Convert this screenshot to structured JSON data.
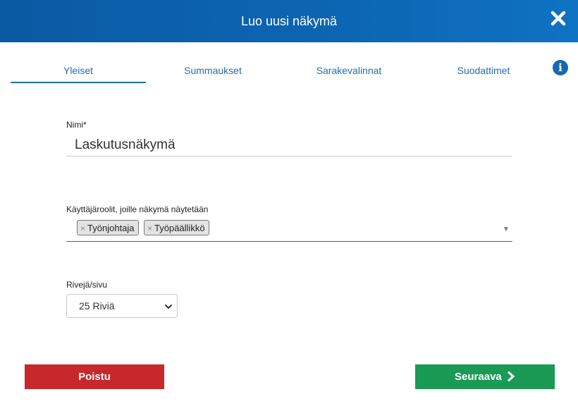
{
  "dialog": {
    "title": "Luo uusi näkymä",
    "close_icon": "close-icon"
  },
  "tabs": [
    {
      "label": "Yleiset",
      "active": true
    },
    {
      "label": "Summaukset",
      "active": false
    },
    {
      "label": "Sarakevalinnat",
      "active": false
    },
    {
      "label": "Suodattimet",
      "active": false
    }
  ],
  "info_icon": {
    "glyph": "i",
    "icon": "info-icon"
  },
  "form": {
    "name": {
      "label": "Nimi*",
      "value": "Laskutusnäkymä"
    },
    "roles": {
      "label": "Käyttäjäroolit, joille näkymä näytetään",
      "remove_glyph": "×",
      "caret": "▼",
      "selected": [
        "Työnjohtaja",
        "Työpäällikkö"
      ]
    },
    "rows_per_page": {
      "label": "Rivejä/sivu",
      "selected": "25 Riviä"
    }
  },
  "buttons": {
    "delete_label": "Poistu",
    "next_label": "Seuraava"
  },
  "colors": {
    "header": "#0d66b3",
    "accent": "#1f6fa8",
    "delete": "#c8282b",
    "next": "#1a9a55"
  }
}
